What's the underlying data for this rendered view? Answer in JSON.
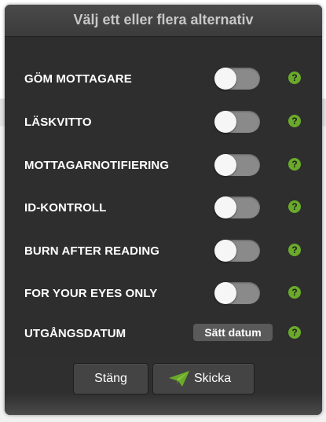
{
  "dialog": {
    "title": "Välj ett eller flera alternativ"
  },
  "options": [
    {
      "label": "GÖM MOTTAGARE",
      "enabled": false
    },
    {
      "label": "LÄSKVITTO",
      "enabled": false
    },
    {
      "label": "MOTTAGARNOTIFIERING",
      "enabled": false
    },
    {
      "label": "ID-KONTROLL",
      "enabled": false
    },
    {
      "label": "BURN AFTER READING",
      "enabled": false
    },
    {
      "label": "FOR YOUR EYES ONLY",
      "enabled": false
    }
  ],
  "expiry": {
    "label": "UTGÅNGSDATUM",
    "button_label": "Sätt datum"
  },
  "help_glyph": "?",
  "footer": {
    "close_label": "Stäng",
    "send_label": "Skicka",
    "send_icon": "paper-plane-icon"
  },
  "colors": {
    "dialog_bg": "#2e2e2e",
    "accent_green": "#6aaa2a",
    "toggle_off": "#8a8a8a"
  }
}
